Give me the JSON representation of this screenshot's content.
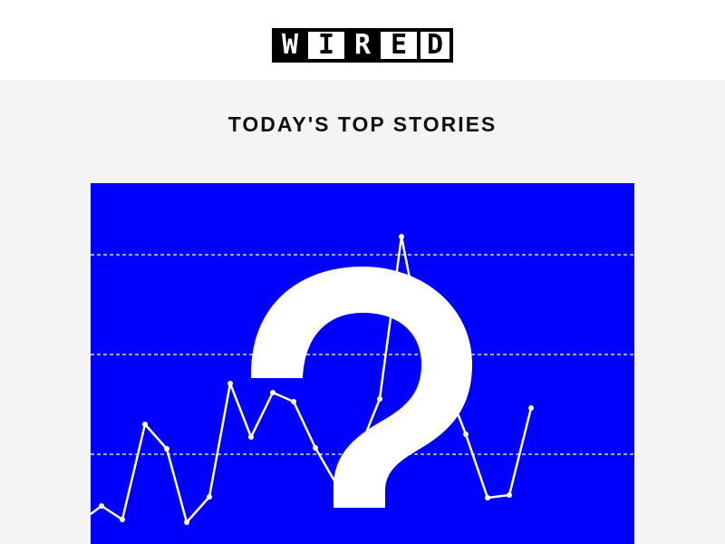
{
  "brand": {
    "logo_letters": [
      "W",
      "I",
      "R",
      "E",
      "D"
    ],
    "colors": {
      "header_bg": "#ffffff",
      "page_bg": "#f4f4f4",
      "logo_ink": "#000000"
    }
  },
  "newsletter": {
    "section_title": "TODAY'S TOP STORIES"
  },
  "hero_image": {
    "background_color": "#0000ff",
    "line_color": "#ffffff",
    "icon": "question-mark-icon",
    "glyph": "?"
  }
}
